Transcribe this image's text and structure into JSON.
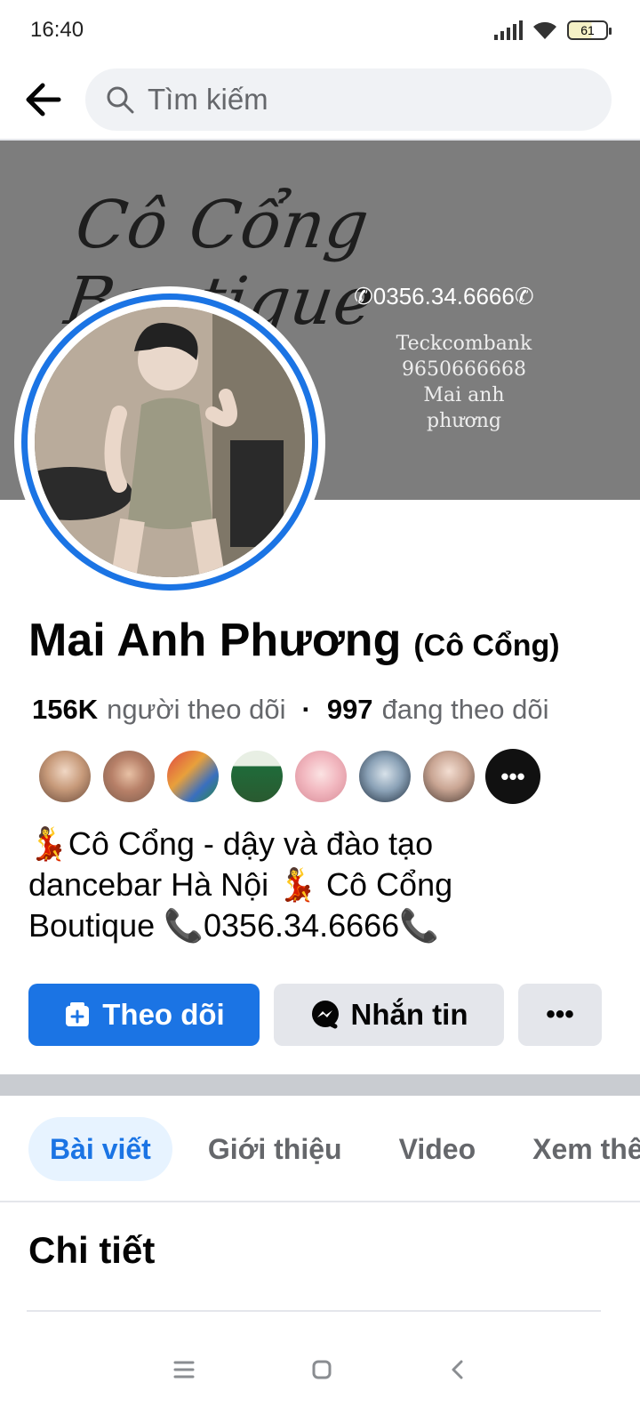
{
  "status_bar": {
    "time": "16:40",
    "battery": "61"
  },
  "search": {
    "placeholder": "Tìm kiếm"
  },
  "cover": {
    "title": "Cô Cổng Boutique",
    "phone": "0356.34.6666",
    "bank_lines": [
      "Teckcombank",
      "9650666668",
      "Mai anh phương"
    ]
  },
  "profile": {
    "name": "Mai Anh Phương",
    "alternate_name": "(Cô Cổng)",
    "followers_count": "156K",
    "followers_label": "người theo dõi",
    "following_count": "997",
    "following_label": "đang theo dõi",
    "more_followers": "•••"
  },
  "bio": {
    "line1": "Cô Cổng - dậy và đào tạo",
    "line2a": "dancebar Hà Nội",
    "line2b": "Cô Cổng",
    "line3a": "Boutique",
    "line3b": "0356.34.6666"
  },
  "actions": {
    "follow_label": "Theo dõi",
    "message_label": "Nhắn tin",
    "more_label": "•••"
  },
  "tabs": [
    "Bài viết",
    "Giới thiệu",
    "Video",
    "Xem thêm"
  ],
  "details": {
    "title": "Chi tiết"
  },
  "colors": {
    "accent": "#1b74e4",
    "cover_bg": "#7d7d7d",
    "chip_bg": "#e4e6eb"
  },
  "icons": [
    "back-arrow-icon",
    "search-icon",
    "signal-icon",
    "wifi-icon",
    "battery-icon",
    "follow-icon",
    "messenger-icon",
    "more-icon",
    "menu-icon",
    "home-icon",
    "back-nav-icon"
  ]
}
